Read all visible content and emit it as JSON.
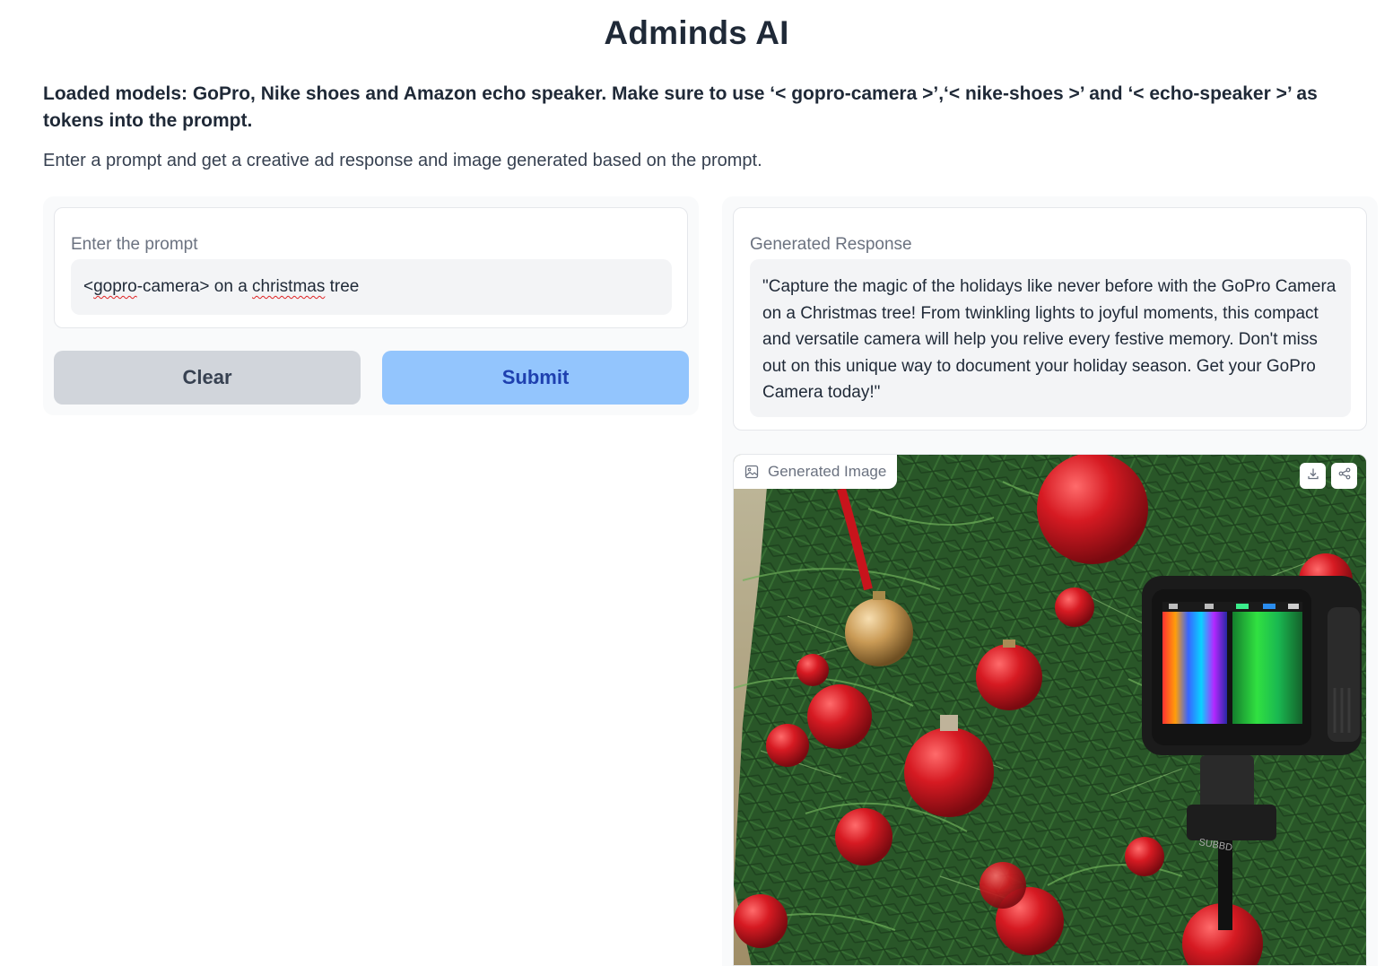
{
  "app": {
    "title": "Adminds AI",
    "description": "Loaded models: GoPro, Nike shoes and Amazon echo speaker. Make sure to use ‘< gopro-camera >’,‘< nike-shoes >’ and ‘< echo-speaker >’ as tokens into the prompt.",
    "subtitle": "Enter a prompt and get a creative ad response and image generated based on the prompt."
  },
  "prompt": {
    "label": "Enter the prompt",
    "value_part1": "<",
    "value_misspelled1": "gopro",
    "value_part2": "-camera> on a ",
    "value_misspelled2": "christmas",
    "value_part3": " tree"
  },
  "buttons": {
    "clear_label": "Clear",
    "submit_label": "Submit"
  },
  "response": {
    "label": "Generated Response",
    "text": "\"Capture the magic of the holidays like never before with the GoPro Camera on a Christmas tree! From twinkling lights to joyful moments, this compact and versatile camera will help you relive every festive memory. Don't miss out on this unique way to document your holiday season. Get your GoPro Camera today!\""
  },
  "image": {
    "label": "Generated Image",
    "download_icon": "download-icon",
    "share_icon": "share-icon"
  },
  "colors": {
    "submit_bg": "#93c5fd",
    "submit_text": "#1e40af",
    "clear_bg": "#d1d5db",
    "panel_bg": "#f9fafb"
  }
}
